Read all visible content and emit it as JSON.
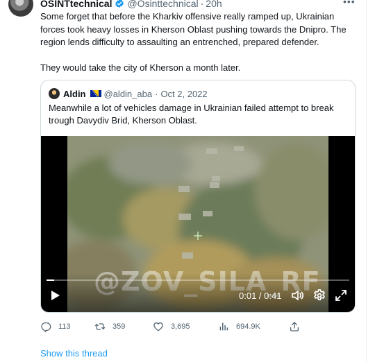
{
  "author": {
    "name": "OSINTtechnical",
    "handle": "@Osinttechnical",
    "time": "20h",
    "verified": true,
    "more_icon": "more-horizontal-icon"
  },
  "tweet": {
    "paragraphs": [
      "Some forget that before the Kharkiv offensive really ramped up, Ukrainian forces took heavy losses in Kherson Oblast pushing towards the Dnipro. The region lends difficulty to assaulting an entrenched, prepared defender.",
      "They would take the city of Kherson a month later."
    ]
  },
  "quote": {
    "name": "Aldin",
    "flag_icon": "bosnia-flag-icon",
    "handle": "@aldin_aba",
    "date": "Oct 2, 2022",
    "text": "Meanwhile a lot of vehicles damage in Ukrainian failed attempt to break trough Davydiv Brid, Kherson Oblast.",
    "video": {
      "watermark": "@ZOV_SILA_RF",
      "time": "0:01 / 0:41",
      "progress": 0.025
    }
  },
  "actions": {
    "replies": "113",
    "retweets": "359",
    "likes": "3,695",
    "views": "694.9K"
  },
  "thread_link": "Show this thread",
  "colors": {
    "link": "#1d9bf0",
    "secondary_text": "#536471",
    "verified_badge": "#1d9bf0",
    "border": "#cfd9de"
  }
}
